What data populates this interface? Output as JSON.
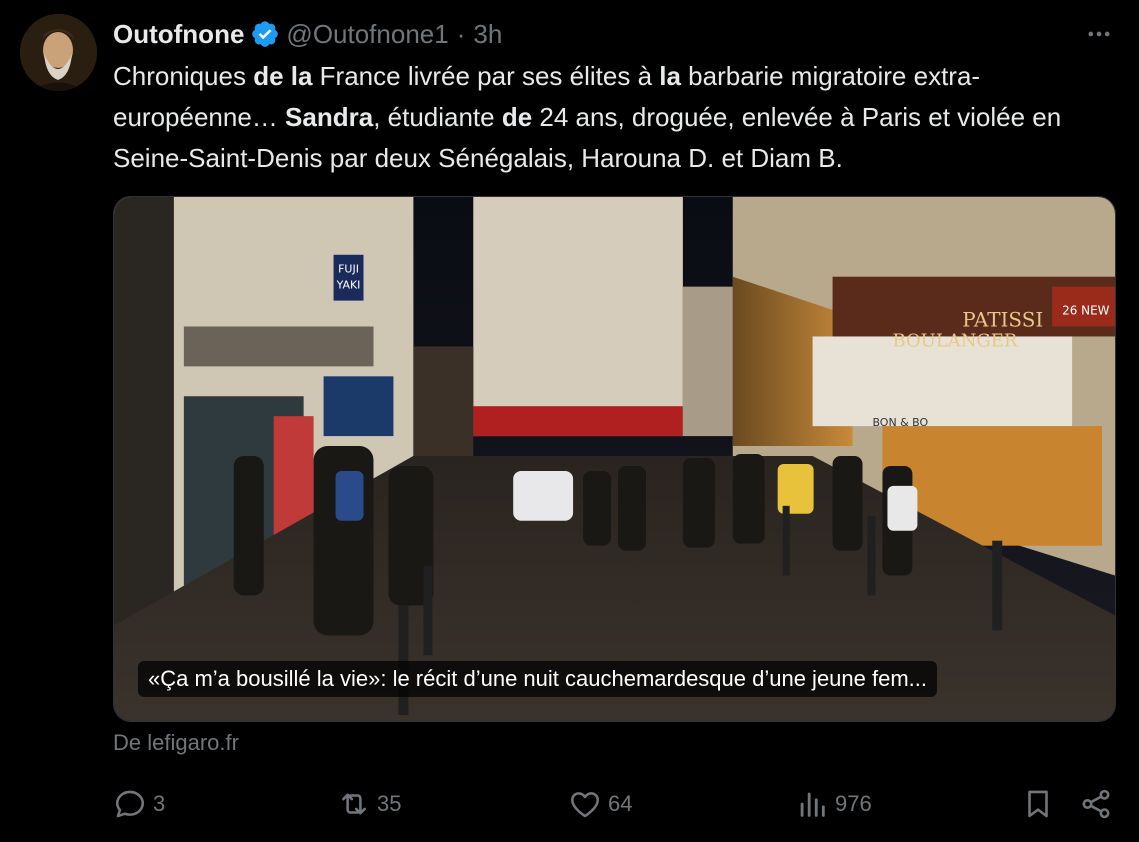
{
  "author": {
    "display_name": "Outofnone",
    "handle": "@Outofnone1",
    "separator": "·",
    "time": "3h"
  },
  "tweet_text": [
    {
      "t": "Chroniques ",
      "b": false
    },
    {
      "t": "de la",
      "b": true
    },
    {
      "t": " France livrée par ses élites à ",
      "b": false
    },
    {
      "t": "la",
      "b": true
    },
    {
      "t": " barbarie migratoire extra-européenne… ",
      "b": false
    },
    {
      "t": "Sandra",
      "b": true
    },
    {
      "t": ", étudiante ",
      "b": false
    },
    {
      "t": "de",
      "b": true
    },
    {
      "t": " 24 ans, droguée, enlevée à Paris et violée en Seine-Saint-Denis par deux Sénégalais, Harouna D. et Diam B.",
      "b": false
    }
  ],
  "card": {
    "title": "«Ça m’a bousillé la vie»: le récit d’une nuit cauchemardesque d’une jeune fem...",
    "photo_signs": [
      "FUJI",
      "YAKI",
      "BOULANGER",
      "PATISSI",
      "26 NEW",
      "BON & BO"
    ]
  },
  "source": "De lefigaro.fr",
  "metrics": {
    "replies": "3",
    "reposts": "35",
    "likes": "64",
    "views": "976"
  },
  "icons": {
    "verified": "verified-badge-icon",
    "more": "more-icon",
    "reply": "reply-icon",
    "repost": "repost-icon",
    "like": "like-icon",
    "views": "views-icon",
    "bookmark": "bookmark-icon",
    "share": "share-icon"
  },
  "colors": {
    "background": "#000000",
    "text": "#e7e9ea",
    "secondary": "#71767b",
    "verified": "#1d9bf0"
  }
}
